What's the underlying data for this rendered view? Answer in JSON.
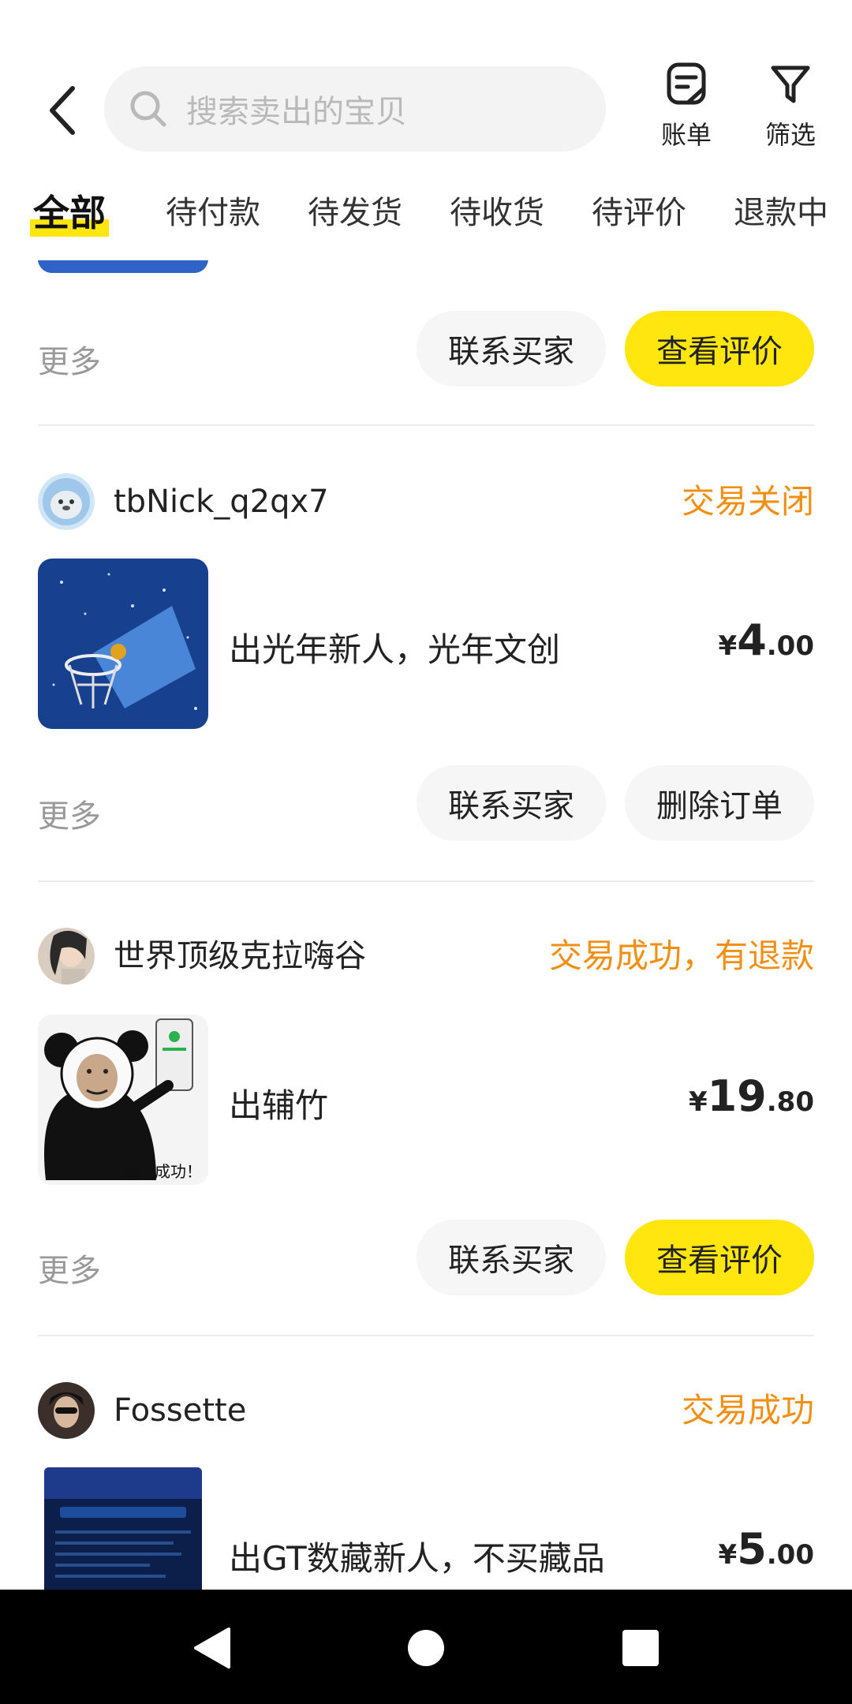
{
  "header": {
    "search_placeholder": "搜索卖出的宝贝",
    "bill_label": "账单",
    "filter_label": "筛选"
  },
  "tabs": [
    {
      "label": "全部",
      "active": true
    },
    {
      "label": "待付款"
    },
    {
      "label": "待发货"
    },
    {
      "label": "待收货"
    },
    {
      "label": "待评价"
    },
    {
      "label": "退款中"
    }
  ],
  "partial_order": {
    "more_label": "更多",
    "contact_label": "联系买家",
    "action_label": "查看评价"
  },
  "orders": [
    {
      "buyer": "tbNick_q2qx7",
      "status": "交易关闭",
      "title": "出光年新人，光年文创",
      "price_currency": "¥",
      "price_int": "4",
      "price_dec": ".00",
      "more_label": "更多",
      "contact_label": "联系买家",
      "action_label": "删除订单"
    },
    {
      "buyer": "世界顶级克拉嗨谷",
      "status": "交易成功，有退款",
      "title": "出辅竹",
      "thumb_caption": "辅助成功！",
      "price_currency": "¥",
      "price_int": "19",
      "price_dec": ".80",
      "more_label": "更多",
      "contact_label": "联系买家",
      "action_label": "查看评价"
    },
    {
      "buyer": "Fossette",
      "status": "交易成功",
      "title": "出GT数藏新人，不买藏品",
      "price_currency": "¥",
      "price_int": "5",
      "price_dec": ".00"
    }
  ],
  "colors": {
    "accent_yellow": "#ffe60f",
    "status_orange": "#f08f14"
  }
}
